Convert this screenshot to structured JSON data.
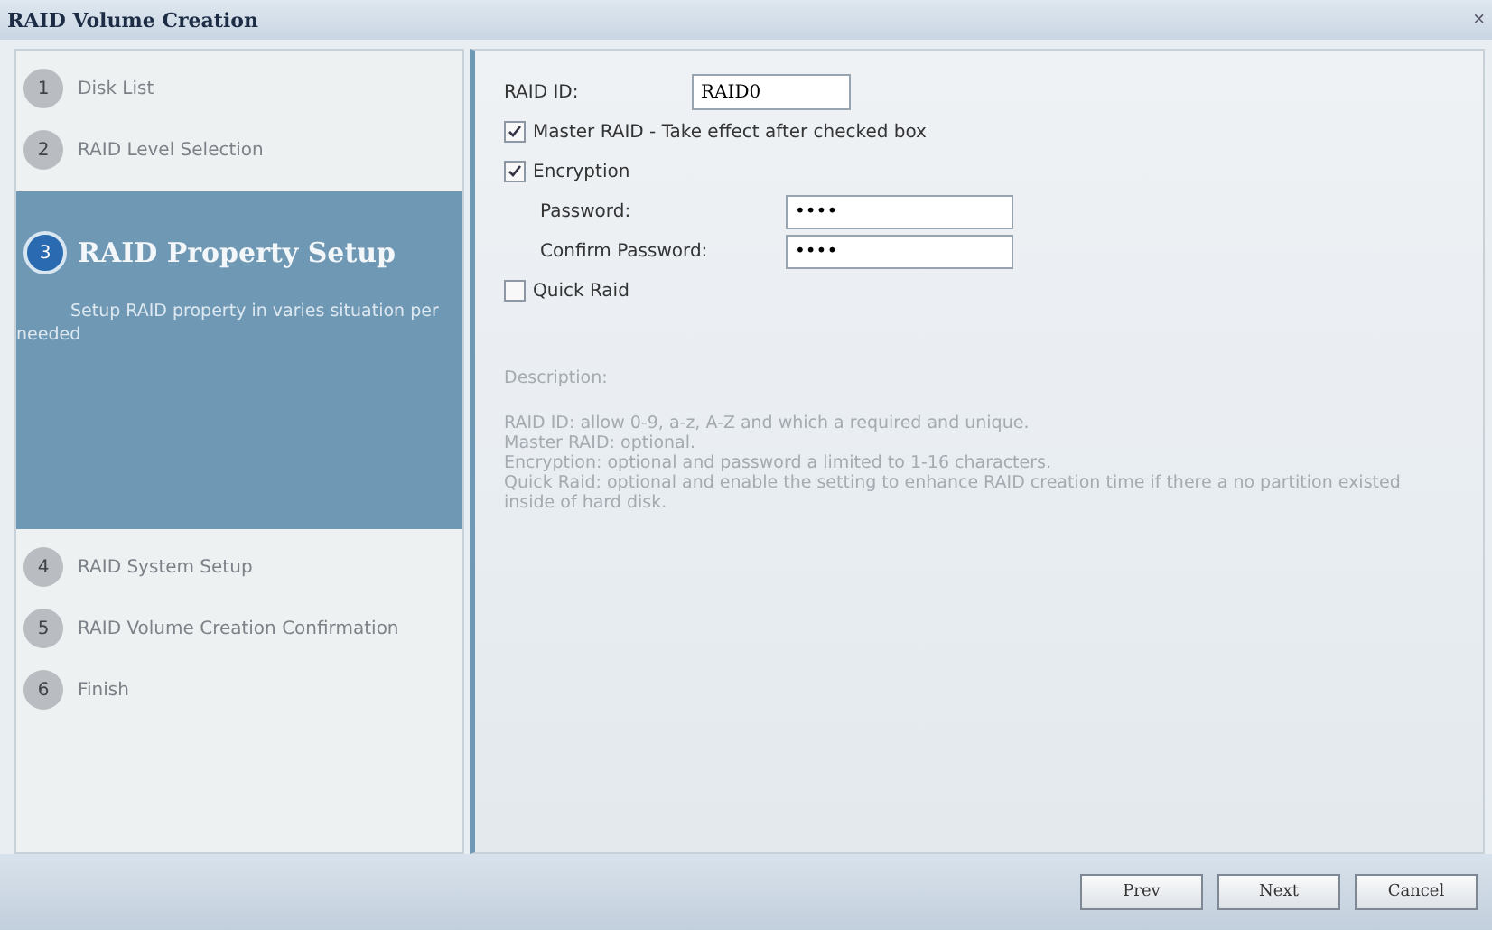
{
  "window": {
    "title": "RAID Volume Creation",
    "close": "×"
  },
  "steps": [
    {
      "number": "1",
      "label": "Disk List",
      "selected": false
    },
    {
      "number": "2",
      "label": "RAID Level Selection",
      "selected": false
    },
    {
      "number": "3",
      "label": "RAID Property Setup",
      "selected": true,
      "description": "Setup RAID property in varies situation per needed"
    },
    {
      "number": "4",
      "label": "RAID System Setup",
      "selected": false
    },
    {
      "number": "5",
      "label": "RAID Volume Creation Confirmation",
      "selected": false
    },
    {
      "number": "6",
      "label": "Finish",
      "selected": false
    }
  ],
  "form": {
    "raid_id": {
      "label": "RAID ID:",
      "value": "RAID0"
    },
    "master_raid": {
      "label": "Master RAID - Take effect after checked box",
      "checked": true
    },
    "encryption": {
      "label": "Encryption",
      "checked": true
    },
    "password": {
      "label": "Password:",
      "value": "••••"
    },
    "confirm_password": {
      "label": "Confirm Password:",
      "value": "••••"
    },
    "quick_raid": {
      "label": "Quick Raid",
      "checked": false
    }
  },
  "description": {
    "title": "Description:",
    "lines": [
      "RAID ID: allow 0-9, a-z, A-Z and which a required and unique.",
      "Master RAID: optional.",
      "Encryption: optional and password a limited to 1-16 characters.",
      "Quick Raid: optional and enable the setting to enhance RAID creation time if there a no partition existed inside of hard disk."
    ]
  },
  "buttons": [
    "Prev",
    "Next",
    "Cancel"
  ]
}
